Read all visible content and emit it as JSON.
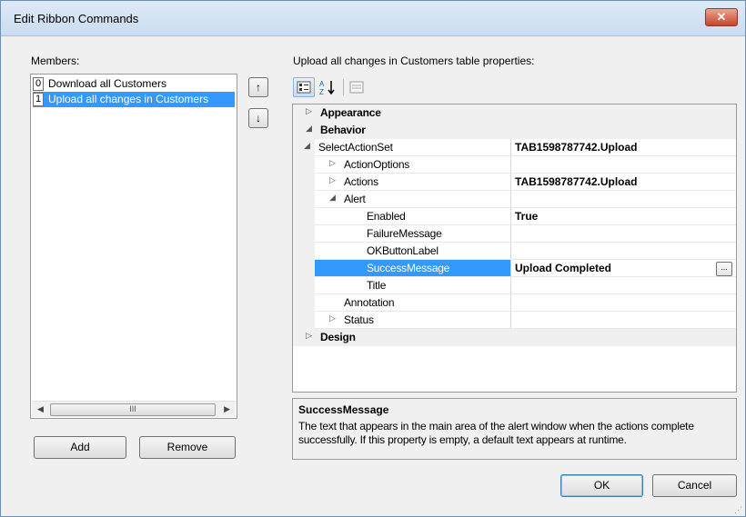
{
  "dialog": {
    "title": "Edit Ribbon Commands",
    "close_label": "✕"
  },
  "members": {
    "label": "Members:",
    "items": [
      {
        "index": "0",
        "label": "Download all Customers"
      },
      {
        "index": "1",
        "label": "Upload all changes in Customers"
      }
    ],
    "selected_index": 1,
    "scroll_thumb_glyph": "III",
    "move_up_glyph": "↑",
    "move_down_glyph": "↓",
    "add_label": "Add",
    "remove_label": "Remove"
  },
  "properties": {
    "header": "Upload all changes in Customers table properties:",
    "rows": [
      {
        "kind": "category",
        "expander": "▷",
        "name": "Appearance"
      },
      {
        "kind": "category",
        "expander": "◢",
        "name": "Behavior"
      },
      {
        "kind": "prop",
        "expander": "◢",
        "name": "SelectActionSet",
        "value": "TAB1598787742.Upload",
        "bold_value": true
      },
      {
        "kind": "prop",
        "expander": "▷",
        "name": "ActionOptions",
        "value": ""
      },
      {
        "kind": "prop",
        "expander": "▷",
        "name": "Actions",
        "value": "TAB1598787742.Upload",
        "bold_value": true
      },
      {
        "kind": "prop",
        "expander": "◢",
        "name": "Alert",
        "value": ""
      },
      {
        "kind": "prop",
        "expander": "",
        "name": "Enabled",
        "value": "True",
        "bold_value": true
      },
      {
        "kind": "prop",
        "expander": "",
        "name": "FailureMessage",
        "value": ""
      },
      {
        "kind": "prop",
        "expander": "",
        "name": "OKButtonLabel",
        "value": ""
      },
      {
        "kind": "prop",
        "expander": "",
        "name": "SuccessMessage",
        "value": "Upload Completed",
        "bold_value": true,
        "selected": true
      },
      {
        "kind": "prop",
        "expander": "",
        "name": "Title",
        "value": ""
      },
      {
        "kind": "prop",
        "expander": "",
        "name": "Annotation",
        "value": ""
      },
      {
        "kind": "prop",
        "expander": "▷",
        "name": "Status",
        "value": ""
      },
      {
        "kind": "category",
        "expander": "▷",
        "name": "Design"
      }
    ],
    "ellipsis_label": "..."
  },
  "description": {
    "title": "SuccessMessage",
    "text": "The text that appears in the main area of the alert window when the actions complete successfully. If this property is empty, a default text appears at runtime."
  },
  "footer": {
    "ok_label": "OK",
    "cancel_label": "Cancel"
  },
  "colors": {
    "selection": "#3399ff",
    "dialog_bg": "#f0f0f0",
    "close_button": "#c9442a"
  }
}
